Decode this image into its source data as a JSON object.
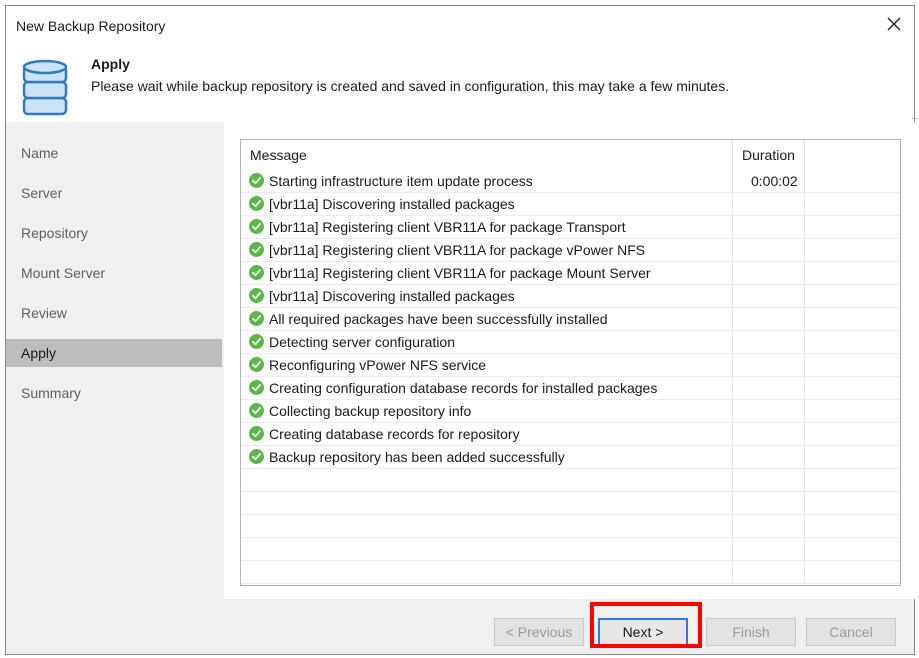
{
  "window": {
    "title": "New Backup Repository"
  },
  "header": {
    "title": "Apply",
    "description": "Please wait while backup repository is created and saved in configuration, this may take a few minutes.",
    "icon": "database-icon"
  },
  "sidebar": {
    "items": [
      {
        "label": "Name",
        "active": false
      },
      {
        "label": "Server",
        "active": false
      },
      {
        "label": "Repository",
        "active": false
      },
      {
        "label": "Mount Server",
        "active": false
      },
      {
        "label": "Review",
        "active": false
      },
      {
        "label": "Apply",
        "active": true
      },
      {
        "label": "Summary",
        "active": false
      }
    ]
  },
  "log": {
    "columns": {
      "message": "Message",
      "duration": "Duration"
    },
    "rows": [
      {
        "message": "Starting infrastructure item update process",
        "duration": "0:00:02",
        "status": "success"
      },
      {
        "message": "[vbr11a] Discovering installed packages",
        "duration": "",
        "status": "success"
      },
      {
        "message": "[vbr11a] Registering client VBR11A for package Transport",
        "duration": "",
        "status": "success"
      },
      {
        "message": "[vbr11a] Registering client VBR11A for package vPower NFS",
        "duration": "",
        "status": "success"
      },
      {
        "message": "[vbr11a] Registering client VBR11A for package Mount Server",
        "duration": "",
        "status": "success"
      },
      {
        "message": "[vbr11a] Discovering installed packages",
        "duration": "",
        "status": "success"
      },
      {
        "message": "All required packages have been successfully installed",
        "duration": "",
        "status": "success"
      },
      {
        "message": "Detecting server configuration",
        "duration": "",
        "status": "success"
      },
      {
        "message": "Reconfiguring vPower NFS service",
        "duration": "",
        "status": "success"
      },
      {
        "message": "Creating configuration database records for installed packages",
        "duration": "",
        "status": "success"
      },
      {
        "message": "Collecting backup repository info",
        "duration": "",
        "status": "success"
      },
      {
        "message": "Creating database records for repository",
        "duration": "",
        "status": "success"
      },
      {
        "message": "Backup repository has been added successfully",
        "duration": "",
        "status": "success"
      }
    ],
    "empty_rows": 5
  },
  "footer": {
    "previous_label": "< Previous",
    "next_label": "Next >",
    "finish_label": "Finish",
    "cancel_label": "Cancel"
  },
  "colors": {
    "success": "#5bb848",
    "highlight": "#ff0000",
    "focus": "#2f7bd5",
    "sidebar_bg": "#f0f0f0",
    "sidebar_active": "#bdbdbd"
  }
}
